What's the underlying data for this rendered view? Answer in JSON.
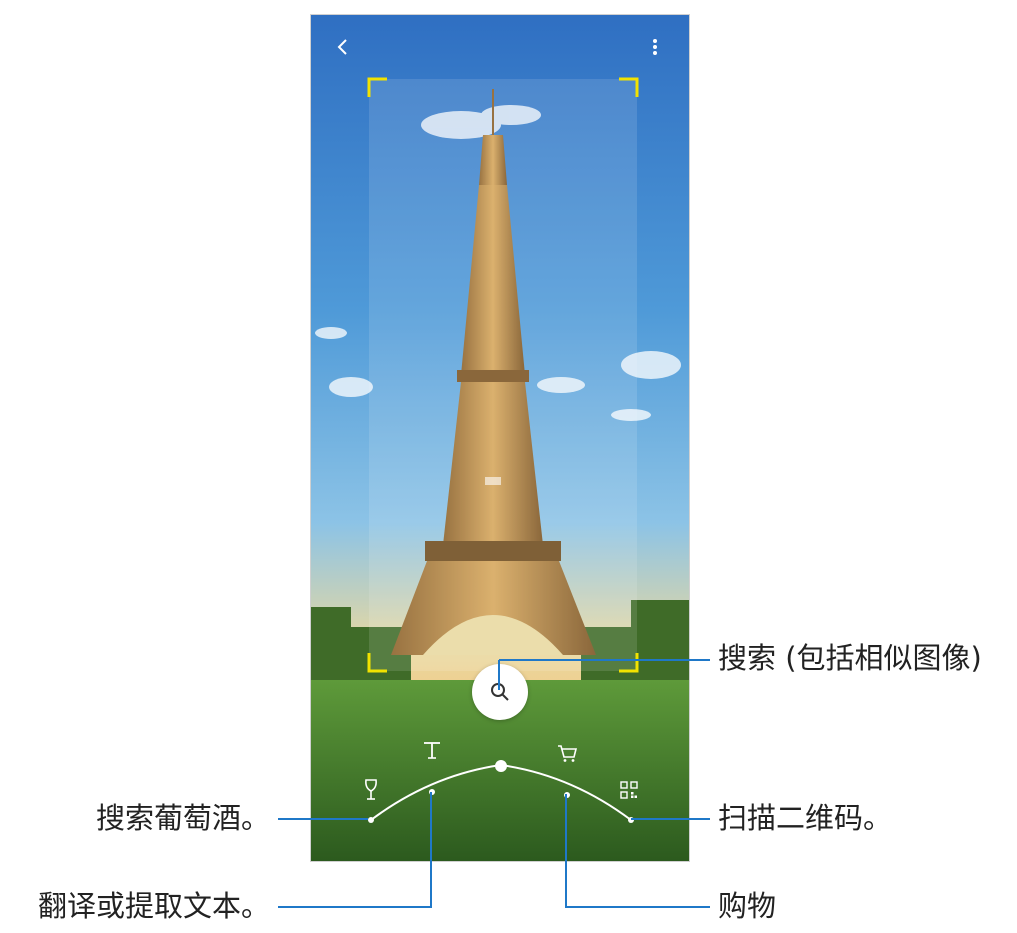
{
  "app": {
    "back_icon": "chevron-left-icon",
    "more_icon": "more-vertical-icon"
  },
  "viewfinder": {
    "accent_color": "#f2e200"
  },
  "modes": [
    {
      "id": "wine",
      "icon": "wine-glass-icon"
    },
    {
      "id": "text",
      "icon": "text-t-icon"
    },
    {
      "id": "search",
      "icon": "search-icon"
    },
    {
      "id": "shopping",
      "icon": "cart-icon"
    },
    {
      "id": "qr",
      "icon": "qr-code-icon"
    }
  ],
  "callouts": {
    "search": "搜索 (包括相似图像)",
    "wine": "搜索葡萄酒。",
    "qr": "扫描二维码。",
    "text": "翻译或提取文本。",
    "shopping": "购物"
  },
  "colors": {
    "callout_line": "#1f78c8",
    "sky_top": "#3a7fcf",
    "grass": "#3e7a2a",
    "tower": "#b8863f"
  }
}
